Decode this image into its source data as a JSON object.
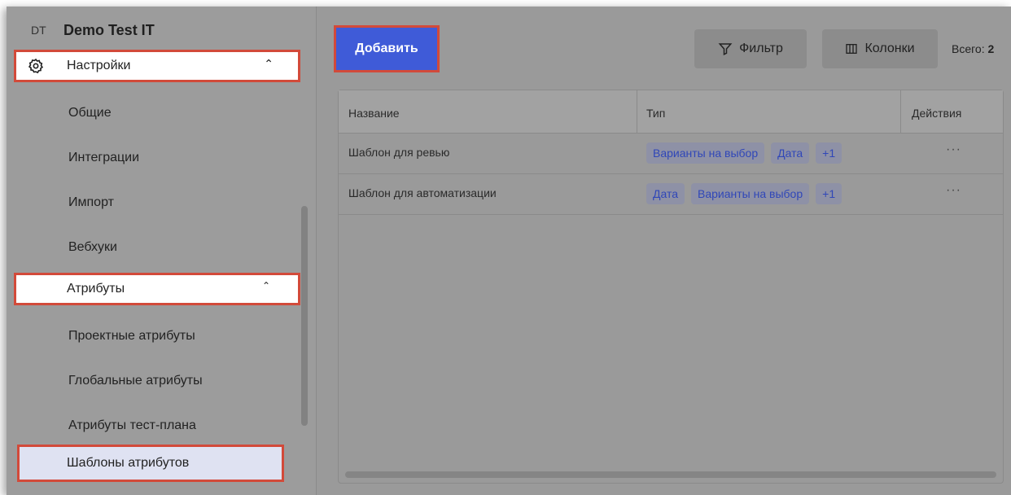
{
  "project": {
    "abbr": "DT",
    "name": "Demo Test IT"
  },
  "sidebar": {
    "settings": {
      "label": "Настройки",
      "chevron": "⌃"
    },
    "items": [
      {
        "label": "Общие"
      },
      {
        "label": "Интеграции"
      },
      {
        "label": "Импорт"
      },
      {
        "label": "Вебхуки"
      }
    ],
    "attributes": {
      "label": "Атрибуты",
      "chevron": "⌃"
    },
    "attr_items": [
      {
        "label": "Проектные атрибуты"
      },
      {
        "label": "Глобальные атрибуты"
      },
      {
        "label": "Атрибуты тест-плана"
      },
      {
        "label": "Шаблоны атрибутов"
      }
    ]
  },
  "toolbar": {
    "add_label": "Добавить",
    "filter_label": "Фильтр",
    "columns_label": "Колонки",
    "total_label": "Всего:",
    "total_value": "2"
  },
  "table": {
    "headers": {
      "name": "Название",
      "type": "Тип",
      "actions": "Действия"
    },
    "rows": [
      {
        "name": "Шаблон для ревью",
        "chips": [
          "Варианты на выбор",
          "Дата",
          "+1"
        ],
        "actions": "···"
      },
      {
        "name": "Шаблон для автоматизации",
        "chips": [
          "Дата",
          "Варианты на выбор",
          "+1"
        ],
        "actions": "···"
      }
    ]
  },
  "colors": {
    "accent": "#3f5bd8",
    "highlight": "#d24a3a",
    "chip_text": "#3047b8"
  }
}
